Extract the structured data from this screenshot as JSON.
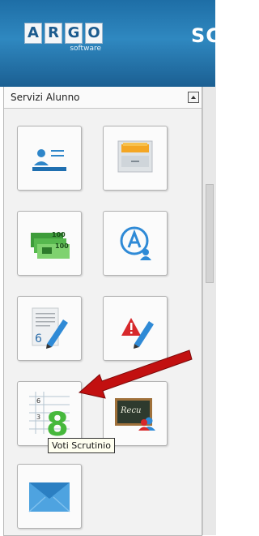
{
  "header": {
    "logo_letters": [
      "A",
      "R",
      "G",
      "O"
    ],
    "logo_subtitle": "software",
    "cut_title": "SC"
  },
  "panel": {
    "title": "Servizi Alunno",
    "tiles": [
      {
        "name": "anagrafe-tile",
        "icon": "id-card-icon"
      },
      {
        "name": "documenti-tile",
        "icon": "file-cabinet-icon"
      },
      {
        "name": "tasse-tile",
        "icon": "banknotes-icon"
      },
      {
        "name": "assenze-tile",
        "icon": "user-a-badge-icon"
      },
      {
        "name": "voti-giornalieri-tile",
        "icon": "grade-pencil-icon"
      },
      {
        "name": "note-disciplinari-tile",
        "icon": "warning-pencil-icon"
      },
      {
        "name": "voti-scrutinio-tile",
        "icon": "grade-sheet-8-icon"
      },
      {
        "name": "recupero-tile",
        "icon": "blackboard-user-icon"
      },
      {
        "name": "messaggi-tile",
        "icon": "envelope-icon"
      }
    ],
    "grade_sheet": {
      "numbers": [
        "6",
        "3"
      ],
      "big": "8"
    },
    "blackboard_text": "Recu",
    "notes_digit": "6",
    "money_labels": [
      "100",
      "100"
    ]
  },
  "tooltip": {
    "text": "Voti Scrutinio"
  },
  "colors": {
    "header": "#2a7fb8",
    "arrow": "#c21010",
    "accent_green": "#46b83c",
    "accent_blue": "#2f8ad6",
    "warning_red": "#d7282b"
  }
}
